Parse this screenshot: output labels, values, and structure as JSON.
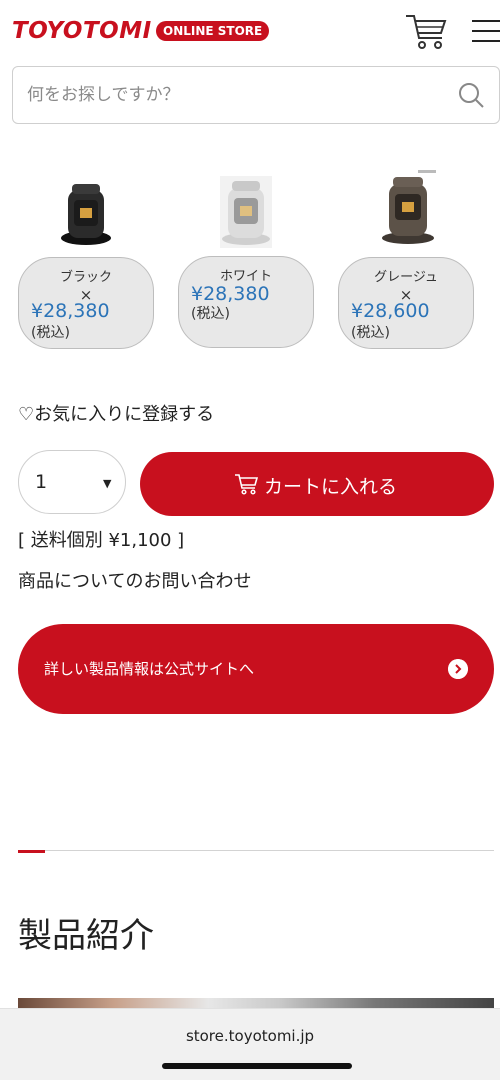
{
  "header": {
    "logo": "TOYOTOMI",
    "store_badge": "ONLINE STORE"
  },
  "search": {
    "placeholder": "何をお探しですか？"
  },
  "variants": [
    {
      "name": "ブラック",
      "times": "×",
      "price": "¥28,380",
      "tax": "(税込)",
      "color": "#2b2b2b"
    },
    {
      "name": "ホワイト",
      "times": "",
      "price": "¥28,380",
      "tax": "(税込)",
      "color": "#dcdcdc"
    },
    {
      "name": "グレージュ",
      "times": "×",
      "price": "¥28,600",
      "tax": "(税込)",
      "color": "#5c5248"
    }
  ],
  "favorite": {
    "label": "♡お気に入りに登録する"
  },
  "quantity": {
    "value": "1"
  },
  "add_to_cart": {
    "label": "カートに入れる"
  },
  "shipping": {
    "text": "[ 送料個別 ¥1,100 ]"
  },
  "inquiry": {
    "text": "商品についてのお問い合わせ"
  },
  "official_site": {
    "label": "詳しい製品情報は公式サイトへ"
  },
  "section": {
    "title": "製品紹介"
  },
  "browser": {
    "url": "store.toyotomi.jp"
  },
  "colors": {
    "brand_red": "#c8101e",
    "price_blue": "#2c74b8"
  }
}
